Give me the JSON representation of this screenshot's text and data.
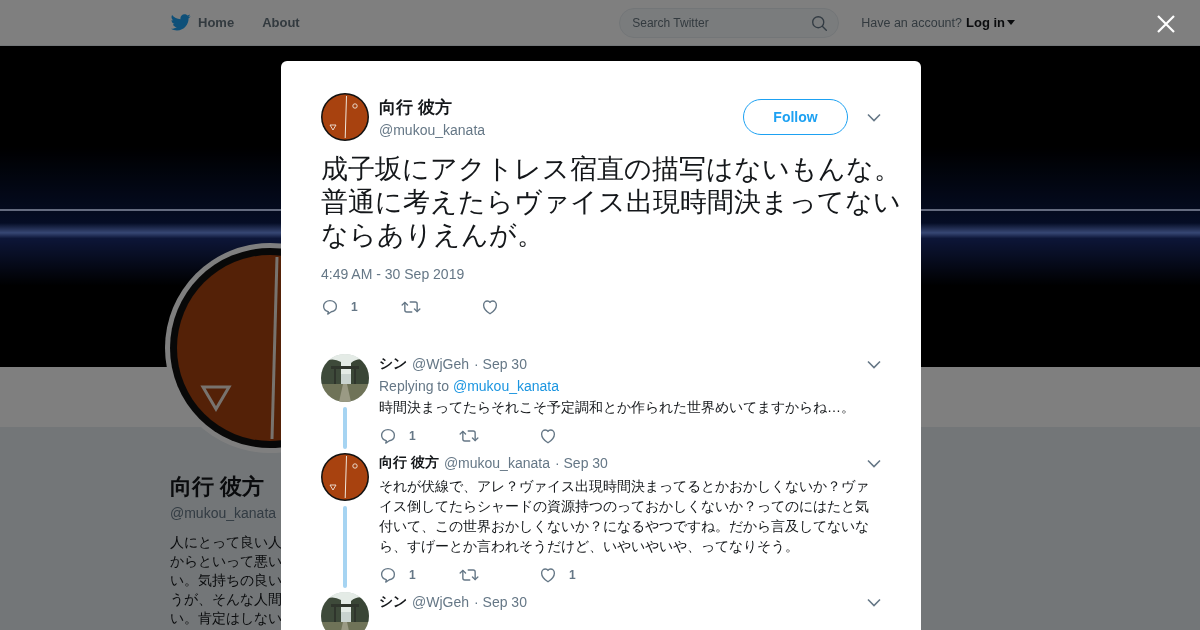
{
  "header": {
    "home": "Home",
    "about": "About",
    "search": {
      "placeholder": "Search Twitter"
    },
    "account_prompt": "Have an account?",
    "login": "Log in"
  },
  "profile": {
    "name": "向行 彼方",
    "handle": "@mukou_kanata",
    "bio_lines": [
      "人にとって良い人",
      "からといって悪い",
      "い。気持ちの良い",
      "うが、そんな人間",
      "い。肯定はしない"
    ]
  },
  "tweet": {
    "name": "向行 彼方",
    "handle": "@mukou_kanata",
    "follow": "Follow",
    "text": "成子坂にアクトレス宿直の描写はないもんな。普通に考えたらヴァイス出現時間決まってないならありえんが。",
    "timestamp": "4:49 AM - 30 Sep 2019",
    "reply_count": "1"
  },
  "replies": [
    {
      "name": "シン",
      "handle": "@WjGeh",
      "date": "· Sep 30",
      "replying_prefix": "Replying to",
      "replying_handle": "@mukou_kanata",
      "text": "時間決まってたらそれこそ予定調和とか作られた世界めいてますからね…。",
      "reply_count": "1",
      "thread": true
    },
    {
      "kind": "logo",
      "name": "向行 彼方",
      "handle": "@mukou_kanata",
      "date": "· Sep 30",
      "text": "それが伏線で、アレ？ヴァイス出現時間決まってるとかおかしくないか？ヴァイス倒してたらシャードの資源持つのっておかしくないか？ってのにはたと気付いて、この世界おかしくないか？になるやつですね。だから言及してないなら、すげーとか言われそうだけど、いやいやいや、ってなりそう。",
      "reply_count": "1",
      "like_count": "1",
      "thread": true
    },
    {
      "name": "シン",
      "handle": "@WjGeh",
      "date": "· Sep 30",
      "thread": false
    }
  ]
}
